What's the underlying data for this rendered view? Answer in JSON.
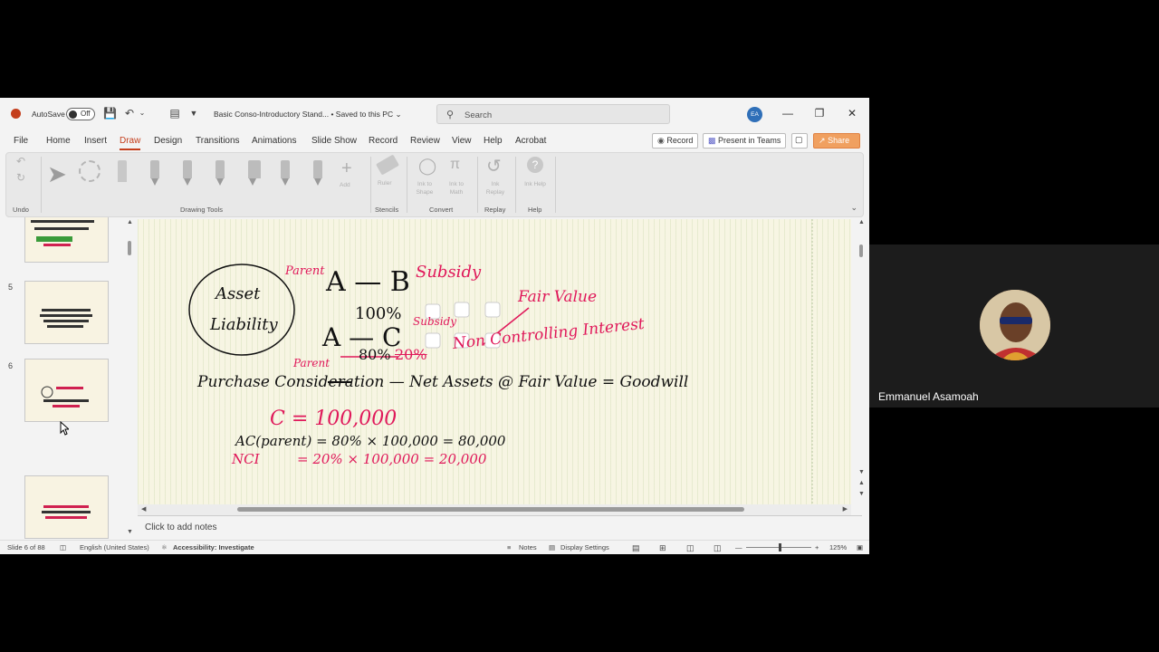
{
  "titlebar": {
    "autosave_label": "AutoSave",
    "autosave_state": "Off",
    "document_title": "Basic Conso-Introductory Stand...  •  Saved to this PC ⌄",
    "search_placeholder": "Search",
    "user_initials": "EA"
  },
  "menu": {
    "items": [
      "File",
      "Home",
      "Insert",
      "Draw",
      "Design",
      "Transitions",
      "Animations",
      "Slide Show",
      "Record",
      "Review",
      "View",
      "Help",
      "Acrobat"
    ],
    "active": "Draw",
    "record_button": "Record",
    "present_button": "Present in Teams",
    "share_button": "Share"
  },
  "ribbon": {
    "groups": [
      "Undo",
      "Drawing Tools",
      "Stencils",
      "Convert",
      "Replay",
      "Help"
    ],
    "add_label": "Add",
    "ruler_label": "Ruler",
    "ink_to_shape": "Ink to Shape",
    "ink_to_math": "Ink to Math",
    "ink_replay": "Ink Replay",
    "ink_help": "Ink Help"
  },
  "thumbnails": {
    "numbers": [
      "5",
      "6",
      "7"
    ],
    "selected": "6"
  },
  "slide": {
    "circle_text_1": "Asset",
    "circle_text_2": "Liability",
    "parent_label": "Parent",
    "a_b": "A — B",
    "subsidy": "Subsidy",
    "hundred_pct": "100%",
    "a_c": "A — C",
    "subsidy_small": "Subsidy",
    "fair_value": "Fair Value",
    "eighty_pct": "80%",
    "twenty_pct": "20%",
    "nci_text": "Non Controlling Interest",
    "parent_label_2": "Parent",
    "equation": "Purchase Consideration — Net Assets @ Fair Value = Goodwill",
    "c_value": "C = 100,000",
    "ac_line": "AC(parent) = 80% × 100,000 = 80,000",
    "nci_line_label": "NCI",
    "nci_line": "= 20% × 100,000 = 20,000"
  },
  "notes_placeholder": "Click to add notes",
  "status": {
    "slide_info": "Slide 6 of 88",
    "language": "English (United States)",
    "accessibility": "Accessibility: Investigate",
    "notes": "Notes",
    "display_settings": "Display Settings",
    "zoom": "125%"
  },
  "video": {
    "participant_name": "Emmanuel Asamoah"
  },
  "colors": {
    "accent": "#c43e1c",
    "ink_red": "#e0185a",
    "ink_black": "#111111"
  }
}
